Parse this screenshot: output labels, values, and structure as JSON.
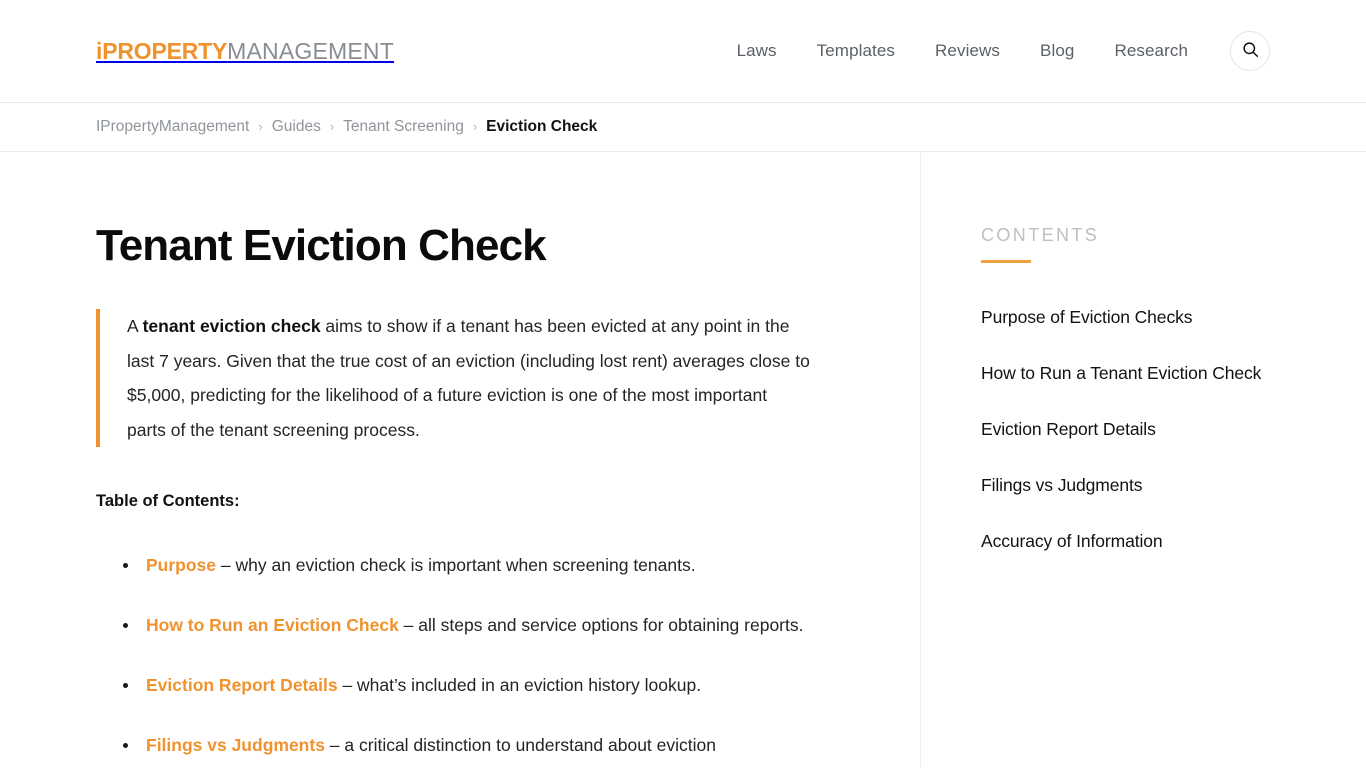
{
  "header": {
    "logo": {
      "i": "i",
      "primary": "PROPERTY",
      "secondary": "MANAGEMENT"
    },
    "nav": [
      {
        "label": "Laws"
      },
      {
        "label": "Templates"
      },
      {
        "label": "Reviews"
      },
      {
        "label": "Blog"
      },
      {
        "label": "Research"
      }
    ],
    "search_icon": "search-icon"
  },
  "breadcrumb": {
    "separator": "›",
    "items": [
      {
        "label": "IPropertyManagement",
        "current": false
      },
      {
        "label": "Guides",
        "current": false
      },
      {
        "label": "Tenant Screening",
        "current": false
      },
      {
        "label": "Eviction Check",
        "current": true
      }
    ]
  },
  "article": {
    "title": "Tenant Eviction Check",
    "intro": {
      "part1": "A ",
      "bold": "tenant eviction check",
      "part2": " aims to show if a tenant has been evicted at any point in the last 7 years. Given that the true cost of an eviction (including lost rent) averages close to $5,000, predicting for the likelihood of a future eviction is one of the most important parts of the tenant screening process."
    },
    "toc_label": "Table of Contents:",
    "toc_items": [
      {
        "link": "Purpose",
        "description": " – why an eviction check is important when screening tenants."
      },
      {
        "link": "How to Run an Eviction Check",
        "description": " – all steps and service options for obtaining reports."
      },
      {
        "link": "Eviction Report Details",
        "description": " – what’s included in an eviction history lookup."
      },
      {
        "link": "Filings vs Judgments",
        "description": " – a critical distinction to understand about eviction"
      }
    ]
  },
  "sidebar": {
    "heading": "CONTENTS",
    "items": [
      {
        "label": "Purpose of Eviction Checks"
      },
      {
        "label": "How to Run a Tenant Eviction Check"
      },
      {
        "label": "Eviction Report Details"
      },
      {
        "label": "Filings vs Judgments"
      },
      {
        "label": "Accuracy of Information"
      }
    ]
  },
  "colors": {
    "accent_orange": "#f0932f",
    "accent_rule": "#efa040",
    "nav_gray": "#5a6066",
    "crumb_gray": "#90959b",
    "heading_gray": "#bcbfc3",
    "text": "#222426"
  }
}
